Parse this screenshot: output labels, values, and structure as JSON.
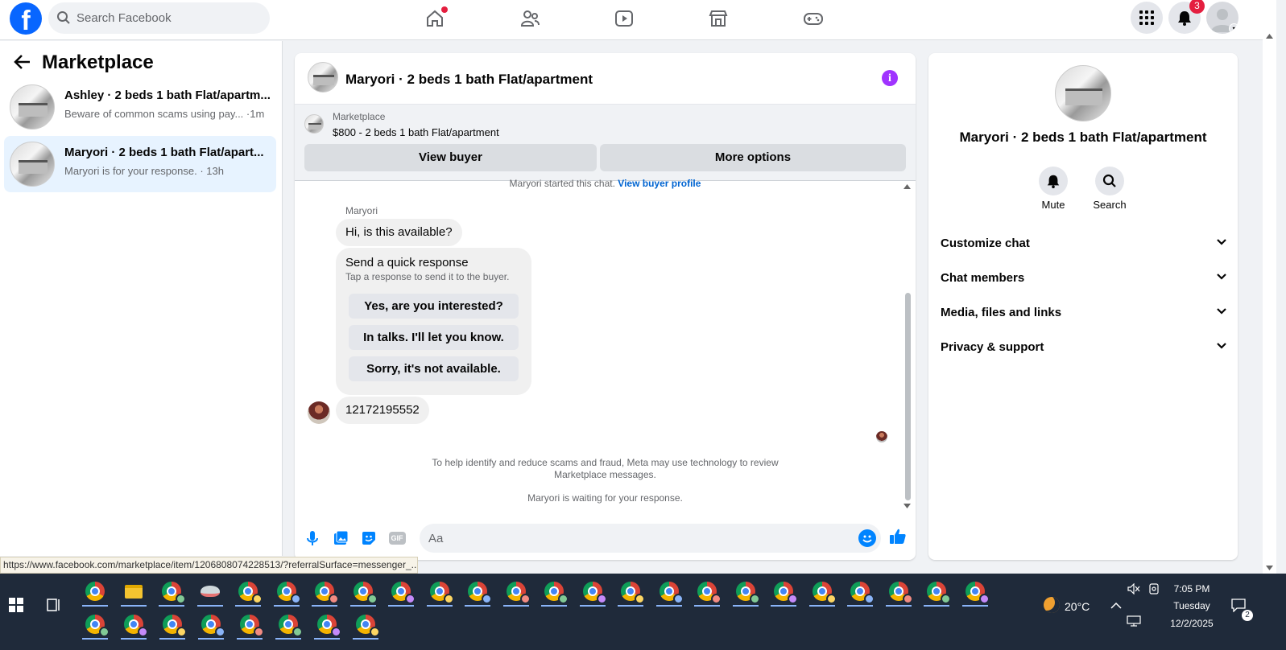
{
  "topbar": {
    "logo": "f",
    "search_placeholder": "Search Facebook",
    "notification_count": "3",
    "icons": [
      "home-icon",
      "friends-icon",
      "video-icon",
      "marketplace-icon",
      "gaming-icon",
      "menu-grid-icon",
      "bell-icon",
      "account-icon"
    ]
  },
  "left": {
    "title": "Marketplace",
    "conversations": [
      {
        "title": "Ashley · 2 beds 1 bath Flat/apartm...",
        "preview": "Beware of common scams using pay... ·1m"
      },
      {
        "title": "Maryori · 2 beds 1 bath Flat/apart...",
        "preview": "Maryori is for your response. · 13h"
      }
    ]
  },
  "chat": {
    "title": "Maryori · 2 beds 1 bath Flat/apartment",
    "listing": {
      "label": "Marketplace",
      "item": "$800 - 2 beds 1 bath Flat/apartment"
    },
    "buttons": {
      "view_buyer": "View buyer",
      "more_options": "More options"
    },
    "started_text": "Maryori started this chat.",
    "started_link": "View buyer profile",
    "sender": "Maryori",
    "message1": "Hi, is this available?",
    "quick": {
      "title": "Send a quick response",
      "subtitle": "Tap a response to send it to the buyer.",
      "options": [
        "Yes, are you interested?",
        "In talks. I'll let you know.",
        "Sorry, it's not available."
      ]
    },
    "message2": "12172195552",
    "notice1": "To help identify and reduce scams and fraud, Meta may use technology to review",
    "notice2": "Marketplace messages.",
    "waiting": "Maryori is waiting for your response.",
    "composer_placeholder": "Aa",
    "gif_label": "GIF"
  },
  "right": {
    "title": "Maryori · 2 beds 1 bath Flat/apartment",
    "actions": {
      "mute": "Mute",
      "search": "Search"
    },
    "sections": [
      "Customize chat",
      "Chat members",
      "Media, files and links",
      "Privacy & support"
    ]
  },
  "status_url": "https://www.facebook.com/marketplace/item/1206808074228513/?referralSurface=messenger_...",
  "taskbar": {
    "weather": "20°C",
    "time": "7:05 PM",
    "day": "Tuesday",
    "date": "12/2/2025",
    "notif_count": "2"
  },
  "colors": {
    "accent": "#0866ff",
    "info": "#a033ff",
    "active_row": "#e7f3ff",
    "taskbar": "#1f2a3a"
  }
}
